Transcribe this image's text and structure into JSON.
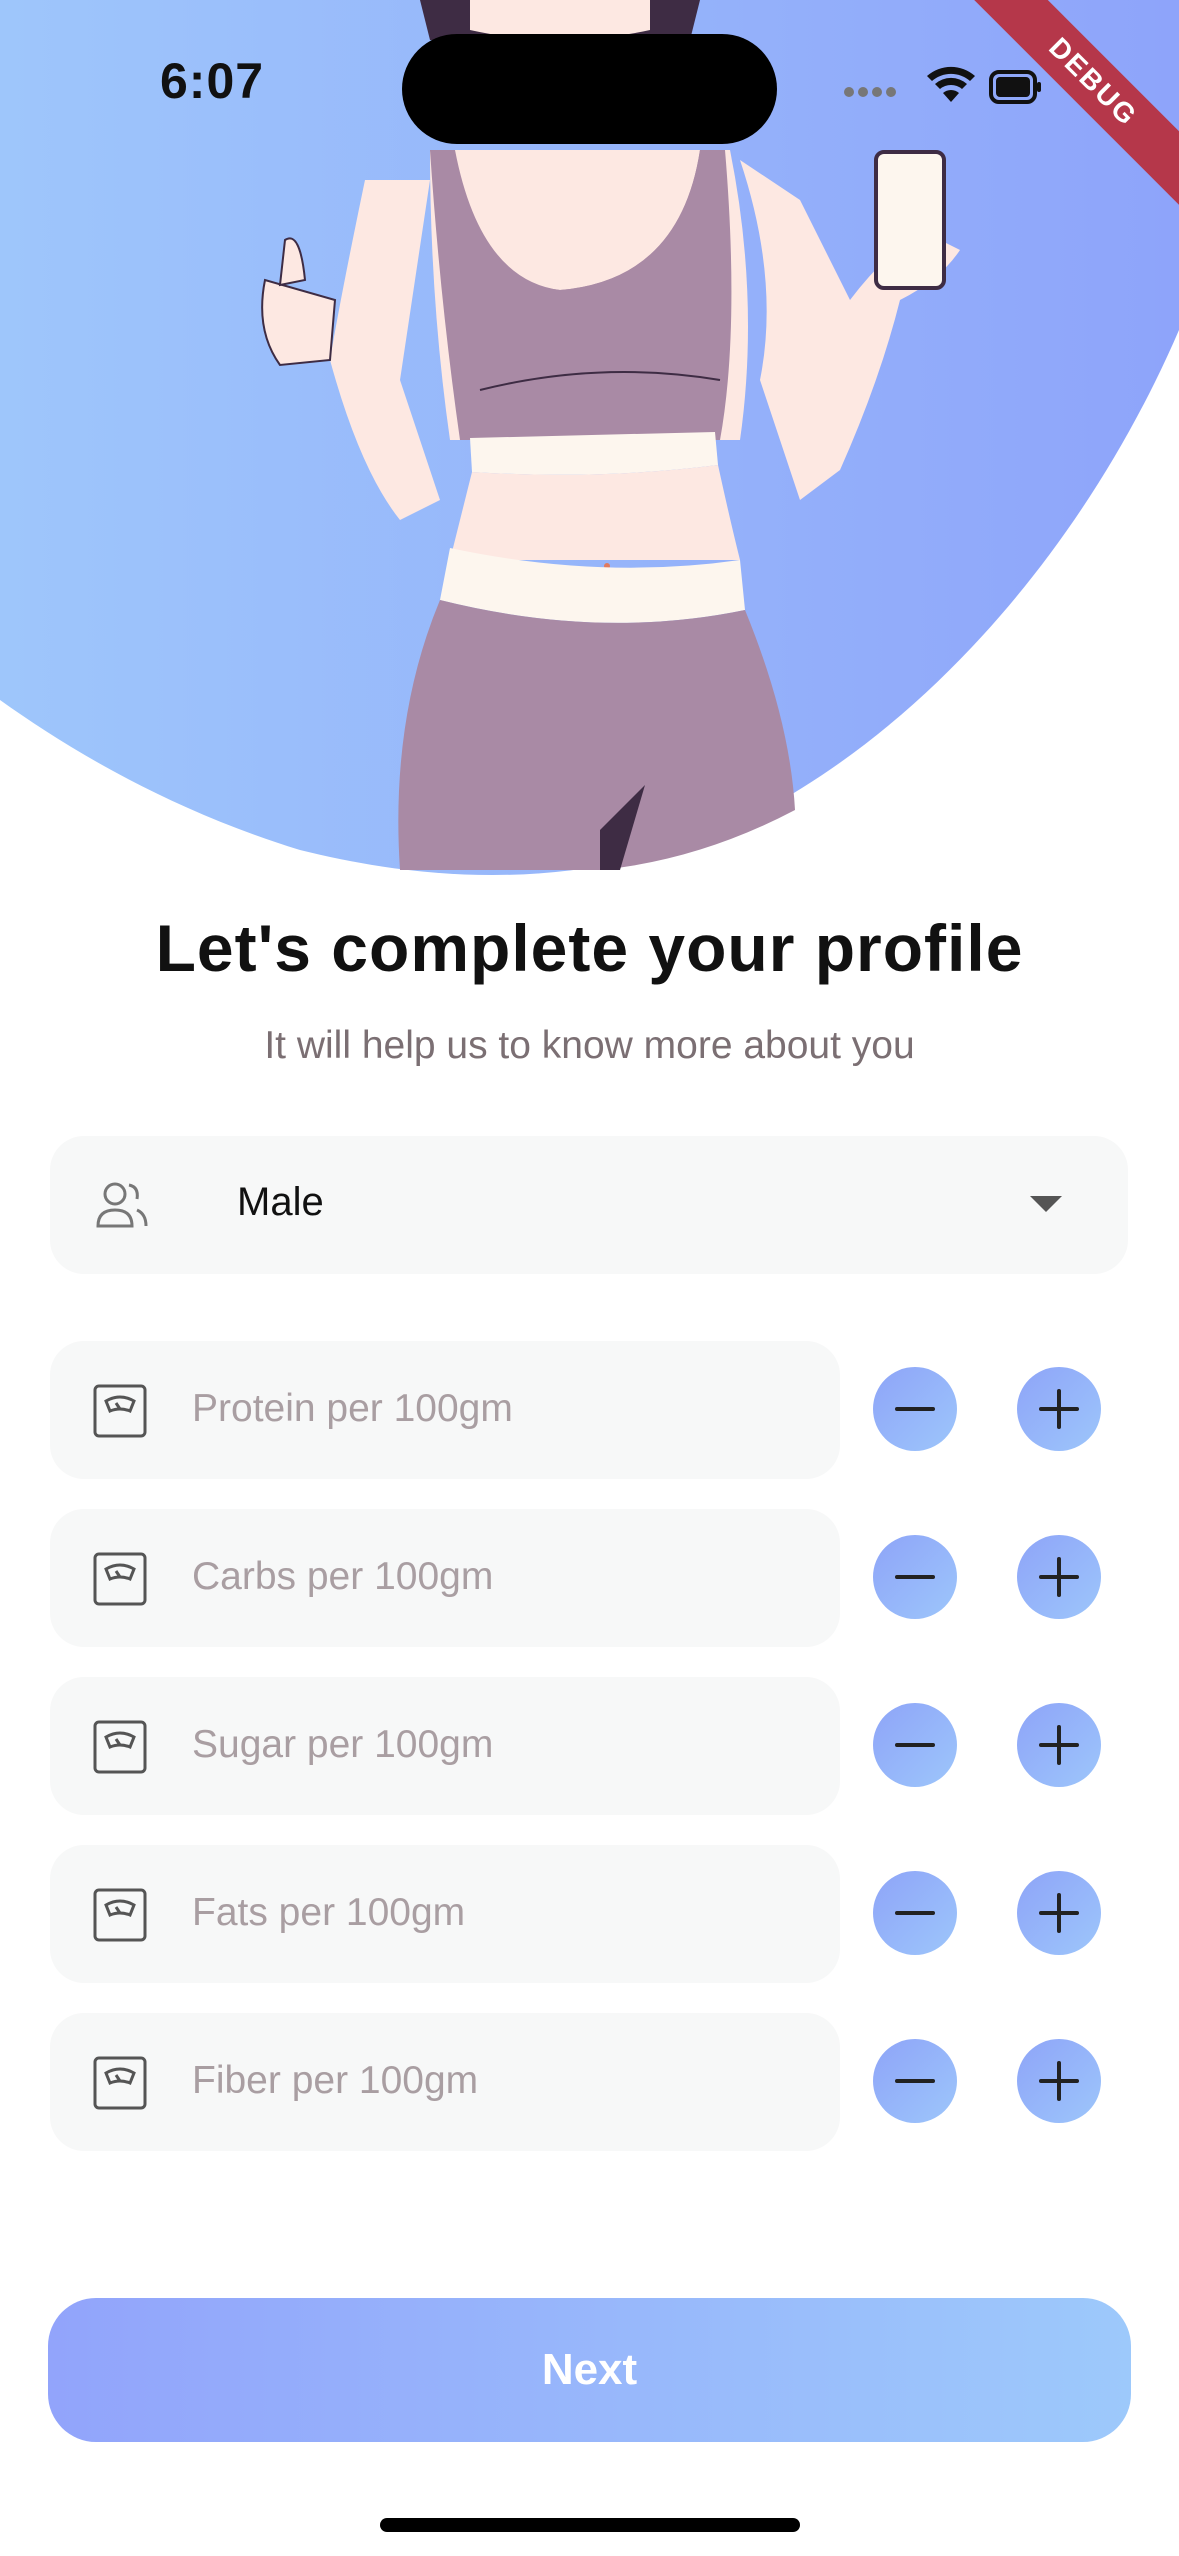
{
  "status": {
    "time": "6:07",
    "debug_label": "DEBUG"
  },
  "page": {
    "title": "Let's complete your profile",
    "subtitle": "It will help us to know more about you"
  },
  "gender_select": {
    "value": "Male",
    "icon": "users-icon"
  },
  "nutrient_fields": [
    {
      "placeholder": "Protein per 100gm",
      "icon": "scale-icon"
    },
    {
      "placeholder": "Carbs per 100gm",
      "icon": "scale-icon"
    },
    {
      "placeholder": "Sugar per 100gm",
      "icon": "scale-icon"
    },
    {
      "placeholder": "Fats per 100gm",
      "icon": "scale-icon"
    },
    {
      "placeholder": "Fiber per 100gm",
      "icon": "scale-icon"
    }
  ],
  "buttons": {
    "next": "Next"
  },
  "colors": {
    "gradient_start": "#92a4fb",
    "gradient_end": "#9dc9fb",
    "field_bg": "#f7f8f8",
    "placeholder": "#a99ea2"
  }
}
